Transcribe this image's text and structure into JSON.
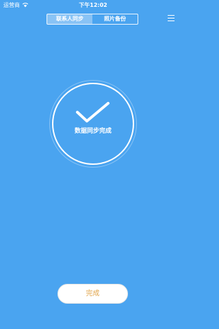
{
  "status": {
    "carrier": "运营商",
    "time": "下午12:02"
  },
  "tabs": [
    {
      "label": "联系人同步",
      "active": true
    },
    {
      "label": "照片备份",
      "active": false
    }
  ],
  "sync": {
    "status_text": "数据同步完成"
  },
  "footer": {
    "done_label": "完成"
  },
  "icons": {
    "wifi": "wifi-icon",
    "menu": "menu-icon",
    "check": "check-icon"
  },
  "colors": {
    "background": "#4aa4f0",
    "done_text": "#e2a54b"
  }
}
